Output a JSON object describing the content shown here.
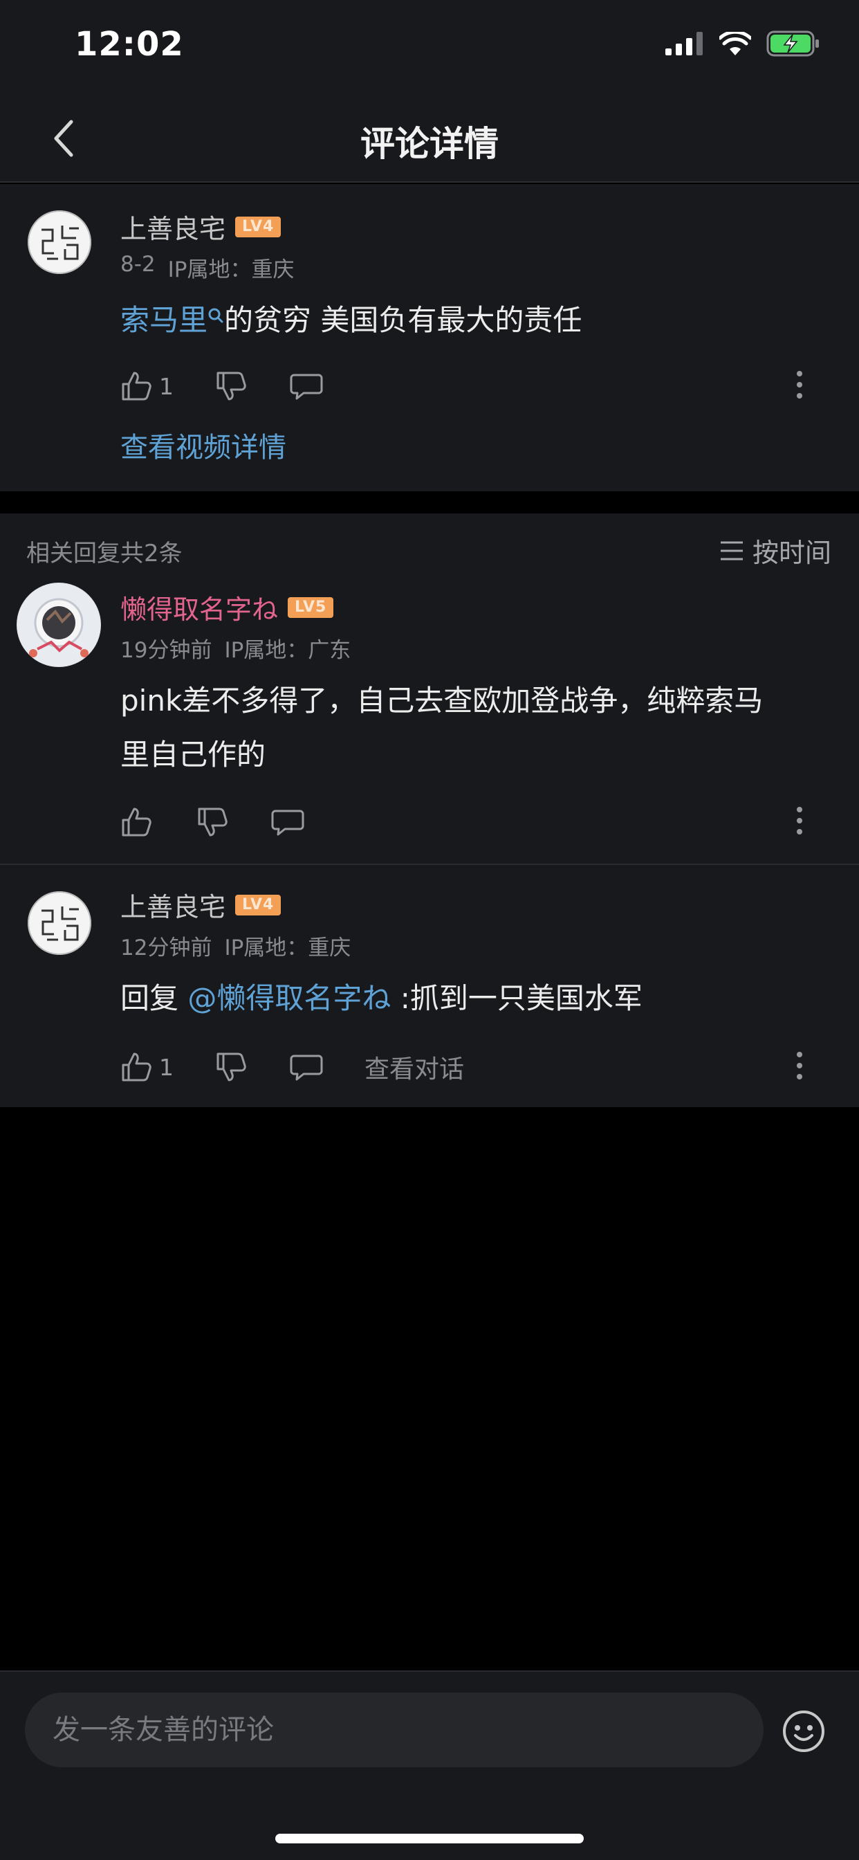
{
  "status": {
    "time": "12:02"
  },
  "nav": {
    "title": "评论详情"
  },
  "main_comment": {
    "username": "上善良宅",
    "level": "LV4",
    "date": "8-2",
    "ip": "IP属地：重庆",
    "link_text": "索马里",
    "text": "的贫穷 美国负有最大的责任",
    "likes": "1",
    "video_link": "查看视频详情"
  },
  "replies_header": {
    "count_text": "相关回复共2条",
    "sort_label": "按时间"
  },
  "replies": [
    {
      "username": "懒得取名字ね",
      "level": "LV5",
      "time": "19分钟前",
      "ip": "IP属地：广东",
      "text_line1": "pink差不多得了，自己去查欧加登战争，纯粹索马",
      "text_line2": "里自己作的"
    },
    {
      "username": "上善良宅",
      "level": "LV4",
      "time": "12分钟前",
      "ip": "IP属地：重庆",
      "reply_prefix": "回复 ",
      "mention": "@懒得取名字ね",
      "text": " :抓到一只美国水军",
      "likes": "1",
      "view_dialog": "查看对话"
    }
  ],
  "input": {
    "placeholder": "发一条友善的评论"
  },
  "colors": {
    "accent_link": "#5fa3d6",
    "pink_name": "#e3648d",
    "level_badge": "#f3a056",
    "background": "#18191c"
  }
}
